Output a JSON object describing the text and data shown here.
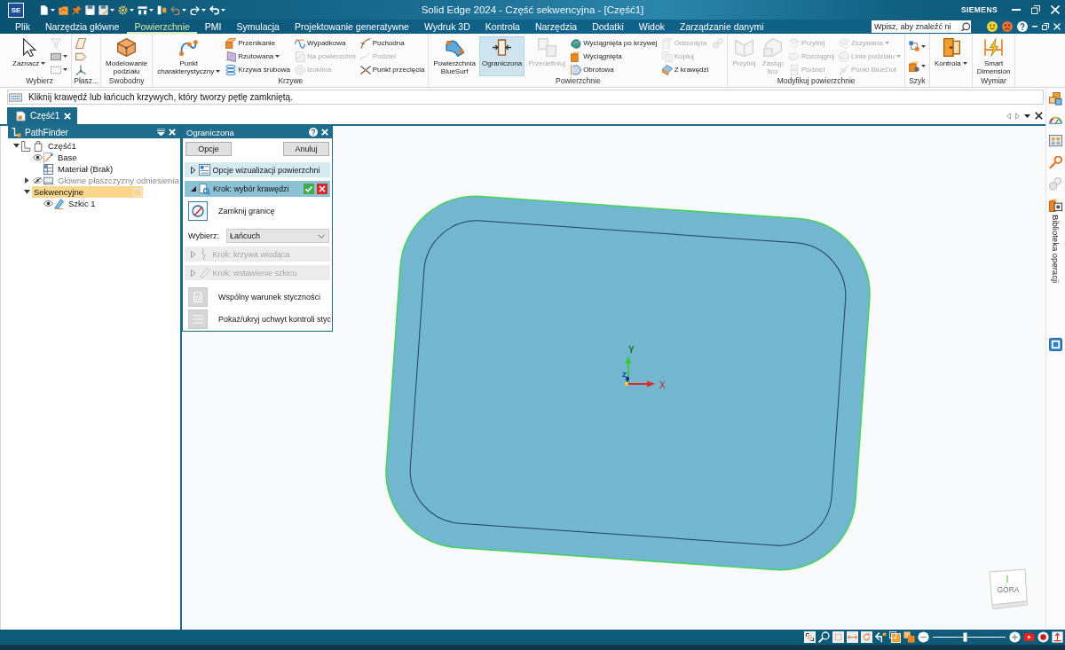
{
  "titlebar": {
    "logo": "SE",
    "title": "Solid Edge 2024 - Część sekwencyjna - [Część1]",
    "brand": "SIEMENS"
  },
  "menu_tabs": [
    {
      "label": "Plik",
      "selected": false
    },
    {
      "label": "Narzędzia główne",
      "selected": false
    },
    {
      "label": "Powierzchnie",
      "selected": true
    },
    {
      "label": "PMI",
      "selected": false
    },
    {
      "label": "Symulacja",
      "selected": false
    },
    {
      "label": "Projektowanie generatywne",
      "selected": false
    },
    {
      "label": "Wydruk 3D",
      "selected": false
    },
    {
      "label": "Kontrola",
      "selected": false
    },
    {
      "label": "Narzędzia",
      "selected": false
    },
    {
      "label": "Dodatki",
      "selected": false
    },
    {
      "label": "Widok",
      "selected": false
    },
    {
      "label": "Zarządzanie danymi",
      "selected": false
    }
  ],
  "search": {
    "placeholder": "Wpisz, aby znaleźć ni"
  },
  "ribbon": [
    {
      "label": "Wybierz",
      "items": [
        {
          "kind": "large",
          "label": "Zaznacz",
          "dropdown": true,
          "disabled": false,
          "selected": false
        },
        {
          "kind": "icon",
          "dropdown": false,
          "disabled": true,
          "selected": false
        },
        {
          "kind": "icon",
          "dropdown": true,
          "disabled": false,
          "selected": false
        },
        {
          "kind": "icon",
          "dropdown": true,
          "disabled": false,
          "selected": false
        }
      ]
    },
    {
      "label": "Płasz...",
      "items": [
        {
          "kind": "icon",
          "dropdown": false,
          "disabled": false,
          "selected": false
        },
        {
          "kind": "icon",
          "dropdown": false,
          "disabled": false,
          "selected": false
        },
        {
          "kind": "icon",
          "dropdown": false,
          "disabled": false,
          "selected": false
        }
      ]
    },
    {
      "label": "Swobodny",
      "items": [
        {
          "kind": "large",
          "label": "Modelowanie podziału",
          "dropdown": false,
          "disabled": false,
          "selected": false
        }
      ]
    },
    {
      "label": "Krzywe",
      "items": [
        {
          "kind": "large",
          "label": "Punkt charakterystyczny",
          "dropdown": true,
          "disabled": false,
          "selected": false
        },
        {
          "kind": "small",
          "label": "Przenikanie",
          "dropdown": false,
          "disabled": false,
          "selected": false
        },
        {
          "kind": "small",
          "label": "Rzutowana",
          "dropdown": true,
          "disabled": false,
          "selected": false
        },
        {
          "kind": "small",
          "label": "Krzywa śrubowa",
          "dropdown": false,
          "disabled": false,
          "selected": false
        },
        {
          "kind": "small",
          "label": "Wypadkowa",
          "dropdown": false,
          "disabled": false,
          "selected": false
        },
        {
          "kind": "small",
          "label": "Na powierzchni",
          "dropdown": false,
          "disabled": true,
          "selected": false
        },
        {
          "kind": "small",
          "label": "Izoklina",
          "dropdown": false,
          "disabled": true,
          "selected": false
        },
        {
          "kind": "small",
          "label": "Pochodna",
          "dropdown": false,
          "disabled": false,
          "selected": false
        },
        {
          "kind": "small",
          "label": "Podziel",
          "dropdown": false,
          "disabled": true,
          "selected": false
        },
        {
          "kind": "small",
          "label": "Punkt przecięcia",
          "dropdown": false,
          "disabled": false,
          "selected": false
        }
      ]
    },
    {
      "label": "Powierzchnie",
      "items": [
        {
          "kind": "large",
          "label": "Powierzchnia BlueSurf",
          "dropdown": false,
          "disabled": false,
          "selected": false
        },
        {
          "kind": "large",
          "label": "Ograniczona",
          "dropdown": false,
          "disabled": false,
          "selected": true
        },
        {
          "kind": "large",
          "label": "Przedefiniuj",
          "dropdown": false,
          "disabled": true,
          "selected": false
        },
        {
          "kind": "small",
          "label": "Wyciągnięta po krzywej",
          "dropdown": false,
          "disabled": false,
          "selected": false
        },
        {
          "kind": "small",
          "label": "Wyciągnięta",
          "dropdown": false,
          "disabled": false,
          "selected": false
        },
        {
          "kind": "small",
          "label": "Obrotowa",
          "dropdown": false,
          "disabled": false,
          "selected": false
        },
        {
          "kind": "small",
          "label": "Odsunięta",
          "dropdown": false,
          "disabled": true,
          "selected": false
        },
        {
          "kind": "small",
          "label": "Kopiuj",
          "dropdown": false,
          "disabled": true,
          "selected": false
        },
        {
          "kind": "small",
          "label": "Z krawędzi",
          "dropdown": false,
          "disabled": false,
          "selected": false
        },
        {
          "kind": "icon",
          "dropdown": false,
          "disabled": true,
          "selected": false
        }
      ]
    },
    {
      "label": "Modyfikuj powierzchnie",
      "items": [
        {
          "kind": "large",
          "label": "Przytnij",
          "dropdown": false,
          "disabled": true,
          "selected": false
        },
        {
          "kind": "large",
          "label": "Zastąp lico",
          "dropdown": false,
          "disabled": true,
          "selected": false
        },
        {
          "kind": "small",
          "label": "Przytnij",
          "dropdown": false,
          "disabled": true,
          "selected": false
        },
        {
          "kind": "small",
          "label": "Rozciągnij",
          "dropdown": false,
          "disabled": true,
          "selected": false
        },
        {
          "kind": "small",
          "label": "Podziel",
          "dropdown": false,
          "disabled": true,
          "selected": false
        },
        {
          "kind": "small",
          "label": "Zszywana",
          "dropdown": true,
          "disabled": true,
          "selected": false
        },
        {
          "kind": "small",
          "label": "Linia podziału",
          "dropdown": true,
          "disabled": true,
          "selected": false
        },
        {
          "kind": "small",
          "label": "Punkt BlueDot",
          "dropdown": false,
          "disabled": true,
          "selected": false
        }
      ]
    },
    {
      "label": "Szyk",
      "items": [
        {
          "kind": "icon",
          "dropdown": true,
          "disabled": false,
          "selected": false
        },
        {
          "kind": "icon",
          "dropdown": true,
          "disabled": false,
          "selected": false
        }
      ]
    },
    {
      "items": [
        {
          "kind": "large",
          "label": "Kontrola",
          "dropdown": true,
          "disabled": false,
          "selected": false
        }
      ]
    },
    {
      "label": "Wymiar",
      "items": [
        {
          "kind": "large",
          "label": "Smart Dimension",
          "dropdown": false,
          "disabled": false,
          "selected": false
        }
      ]
    }
  ],
  "prompt": "Kliknij krawędź lub łańcuch krzywych, który tworzy pętlę zamkniętą.",
  "document_tabs": [
    {
      "label": "Część1",
      "selected": true
    }
  ],
  "pathfinder": {
    "title": "PathFinder",
    "tree": [
      {
        "label": "Część1",
        "expanded": true,
        "selected": false,
        "children": [
          {
            "label": "Base",
            "visible": true,
            "selected": false
          },
          {
            "label": "Materiał (Brak)",
            "selected": false
          },
          {
            "label": "Główne płaszczyzny odniesienia",
            "expanded": false,
            "visible": false,
            "selected": false
          },
          {
            "label": "Sekwencyjne",
            "expanded": true,
            "selected": true,
            "children": [
              {
                "label": "Szkic 1",
                "visible": true,
                "selected": false
              }
            ]
          }
        ]
      }
    ]
  },
  "command_panel": {
    "title": "Ograniczona",
    "buttons": [
      "Opcje",
      "Anuluj"
    ],
    "sections": [
      {
        "label": "Opcje wizualizacji powierzchni",
        "expanded": false,
        "disabled": false,
        "active": false
      },
      {
        "label": "Krok: wybór krawędzi",
        "expanded": true,
        "disabled": false,
        "active": true,
        "toggle": {
          "label": "Zamknij granicę",
          "selected": true
        },
        "field": {
          "label": "Wybierz:",
          "value": "Łańcuch"
        }
      },
      {
        "label": "Krok: krzywa wiodąca",
        "expanded": false,
        "disabled": true,
        "active": false
      },
      {
        "label": "Krok: wstawienie szkicu",
        "expanded": false,
        "disabled": true,
        "active": false
      }
    ],
    "options": [
      {
        "label": "Wspólny warunek styczności",
        "selected": false
      },
      {
        "label": "Pokaż/ukryj uchwyt kontroli styc",
        "selected": false
      }
    ]
  },
  "graphics": {
    "axis_labels": {
      "x": "X",
      "y": "Y",
      "z": "Z"
    },
    "view_cube": {
      "face_label": "GÓRA"
    }
  },
  "right_dock": {
    "tab_label": "Biblioteka operacji"
  },
  "status_bar": {
    "zoom_slider": {
      "level": 0.45
    }
  }
}
